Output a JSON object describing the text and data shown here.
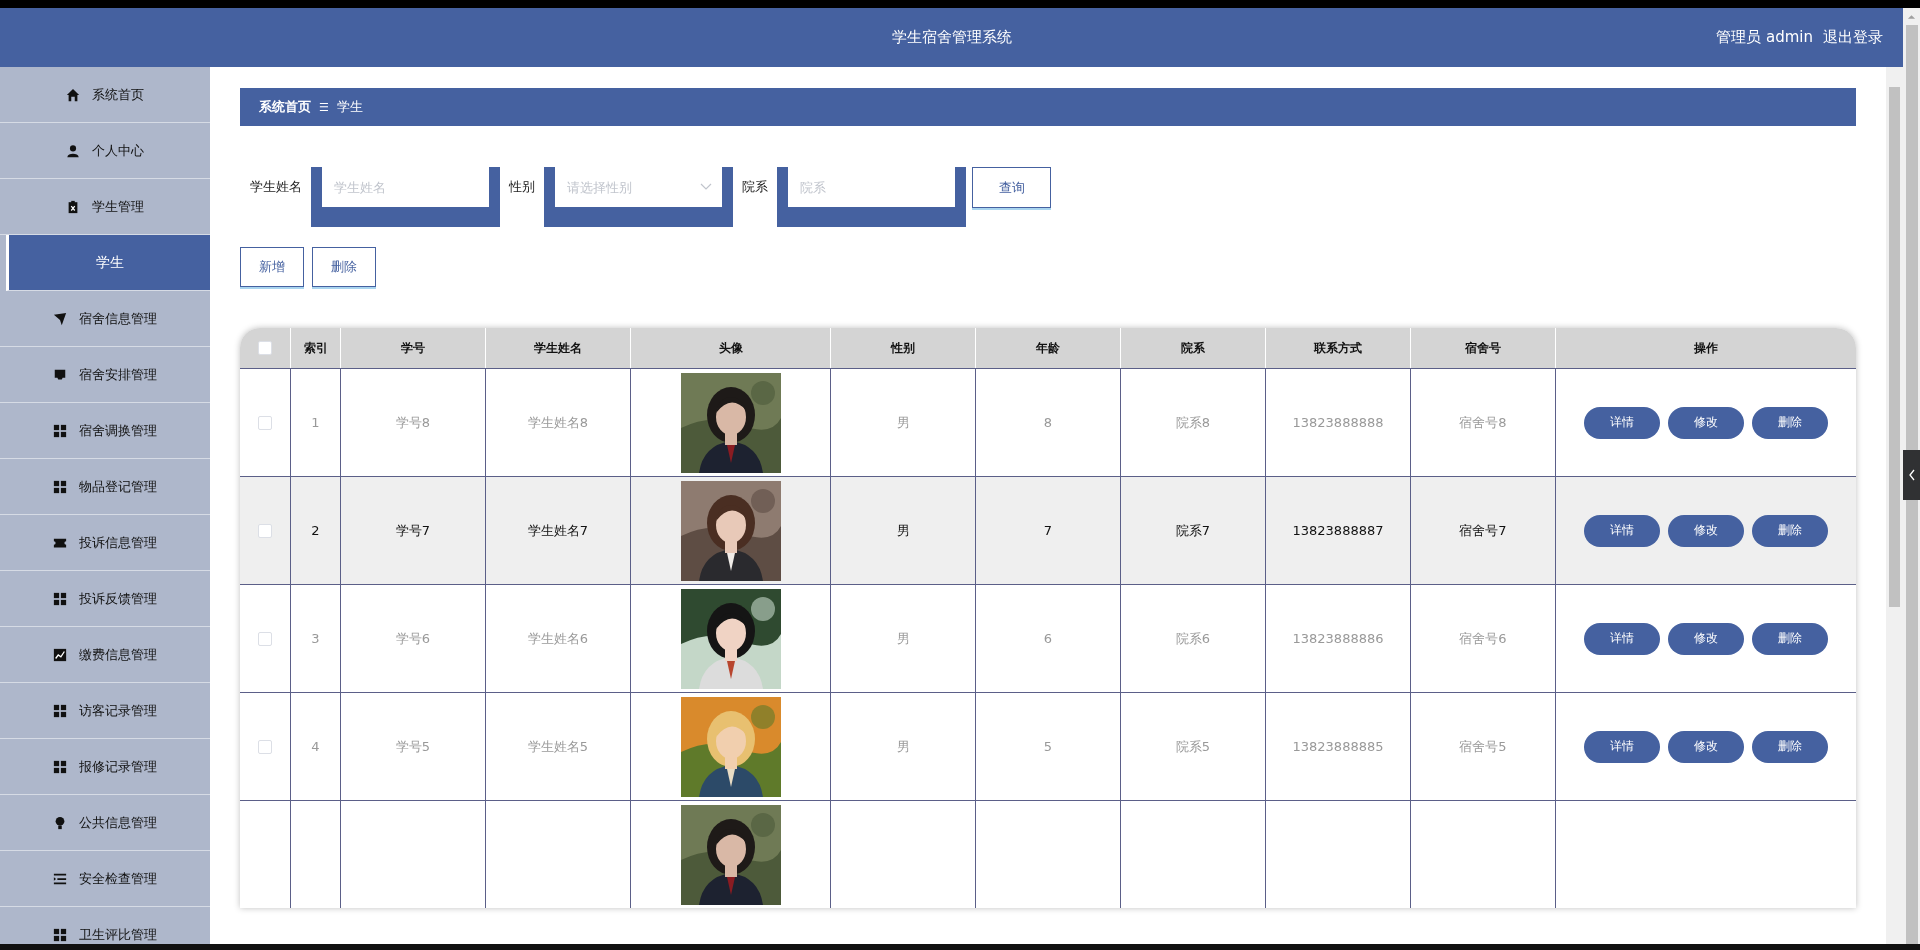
{
  "header": {
    "title": "学生宿舍管理系统",
    "user": "管理员 admin",
    "logout": "退出登录"
  },
  "sidebar": {
    "items": [
      {
        "label": "系统首页",
        "kind": "menu",
        "selected": false
      },
      {
        "label": "个人中心",
        "kind": "menu",
        "selected": false
      },
      {
        "label": "学生管理",
        "kind": "menu",
        "selected": false
      },
      {
        "label": "学生",
        "kind": "submenu",
        "selected": true
      },
      {
        "label": "宿舍信息管理",
        "kind": "menu",
        "selected": false
      },
      {
        "label": "宿舍安排管理",
        "kind": "menu",
        "selected": false
      },
      {
        "label": "宿舍调换管理",
        "kind": "menu",
        "selected": false
      },
      {
        "label": "物品登记管理",
        "kind": "menu",
        "selected": false
      },
      {
        "label": "投诉信息管理",
        "kind": "menu",
        "selected": false
      },
      {
        "label": "投诉反馈管理",
        "kind": "menu",
        "selected": false
      },
      {
        "label": "缴费信息管理",
        "kind": "menu",
        "selected": false
      },
      {
        "label": "访客记录管理",
        "kind": "menu",
        "selected": false
      },
      {
        "label": "报修记录管理",
        "kind": "menu",
        "selected": false
      },
      {
        "label": "公共信息管理",
        "kind": "menu",
        "selected": false
      },
      {
        "label": "安全检查管理",
        "kind": "menu",
        "selected": false
      },
      {
        "label": "卫生评比管理",
        "kind": "menu",
        "selected": false
      }
    ]
  },
  "breadcrumb": {
    "items": [
      "系统首页",
      "学生"
    ],
    "separator": "☰"
  },
  "search": {
    "fields": [
      {
        "label": "学生姓名",
        "placeholder": "学生姓名",
        "kind": "input"
      },
      {
        "label": "性别",
        "placeholder": "请选择性别",
        "kind": "select"
      },
      {
        "label": "院系",
        "placeholder": "院系",
        "kind": "input"
      }
    ],
    "button": "查询"
  },
  "actions": [
    "新增",
    "删除"
  ],
  "table": {
    "select_all_checked": false,
    "columns": [
      "索引",
      "学号",
      "学生姓名",
      "头像",
      "性别",
      "年龄",
      "院系",
      "联系方式",
      "宿舍号",
      "操作"
    ],
    "rows": [
      {
        "checked": false,
        "highlighted": false,
        "index": "1",
        "number": "学号8",
        "name": "学生姓名8",
        "avatar": {
          "kind": "picture"
        },
        "gender": "男",
        "age": "8",
        "department": "院系8",
        "phone": "13823888888",
        "room": "宿舍号8",
        "actions": [
          "详情",
          "修改",
          "删除"
        ]
      },
      {
        "checked": false,
        "highlighted": true,
        "index": "2",
        "number": "学号7",
        "name": "学生姓名7",
        "avatar": {
          "kind": "picture"
        },
        "gender": "男",
        "age": "7",
        "department": "院系7",
        "phone": "13823888887",
        "room": "宿舍号7",
        "actions": [
          "详情",
          "修改",
          "删除"
        ]
      },
      {
        "checked": false,
        "highlighted": false,
        "index": "3",
        "number": "学号6",
        "name": "学生姓名6",
        "avatar": {
          "kind": "picture"
        },
        "gender": "男",
        "age": "6",
        "department": "院系6",
        "phone": "13823888886",
        "room": "宿舍号6",
        "actions": [
          "详情",
          "修改",
          "删除"
        ]
      },
      {
        "checked": false,
        "highlighted": false,
        "index": "4",
        "number": "学号5",
        "name": "学生姓名5",
        "avatar": {
          "kind": "picture"
        },
        "gender": "男",
        "age": "5",
        "department": "院系5",
        "phone": "13823888885",
        "room": "宿舍号5",
        "actions": [
          "详情",
          "修改",
          "删除"
        ]
      },
      {
        "avatar": {
          "kind": "picture"
        }
      }
    ]
  }
}
